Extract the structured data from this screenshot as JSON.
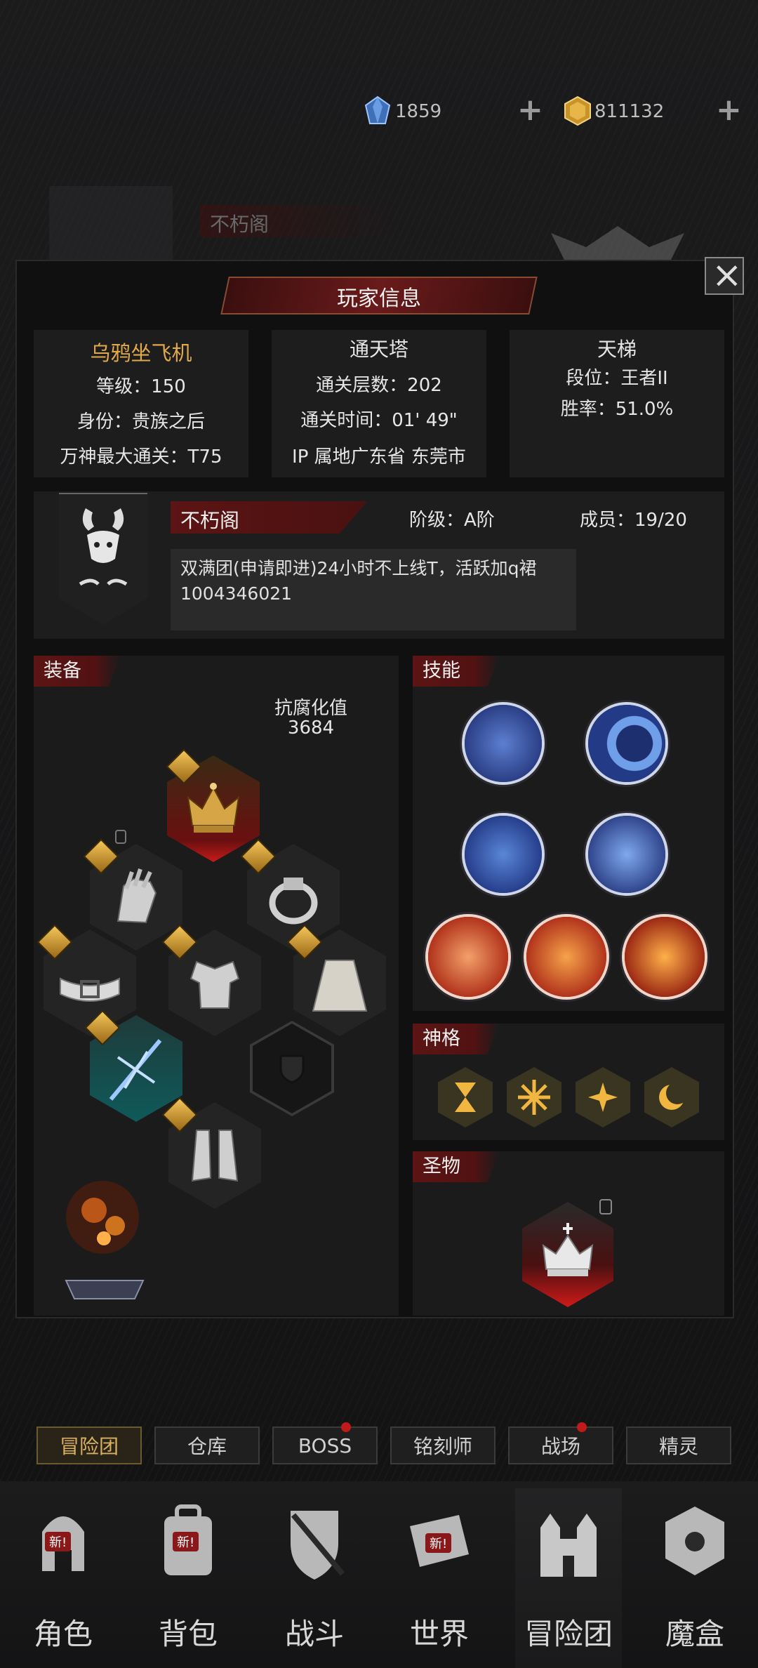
{
  "currency": {
    "gems": "1859",
    "gold": "811132",
    "plus": "+"
  },
  "background": {
    "guild_name": "不朽阁"
  },
  "dialog": {
    "title": "玩家信息",
    "close": "×"
  },
  "player": {
    "name": "乌鸦坐飞机",
    "level": "等级：150",
    "identity": "身份：贵族之后",
    "pantheon": "万神最大通关：T75"
  },
  "tower": {
    "title": "通天塔",
    "floors": "通关层数：202",
    "time": "通关时间：01' 49\"",
    "ip": "IP 属地广东省 东莞市"
  },
  "ladder": {
    "title": "天梯",
    "rank": "段位：王者II",
    "winrate": "胜率：51.0%"
  },
  "guild": {
    "name": "不朽阁",
    "tier": "阶级：A阶",
    "members": "成员：19/20",
    "notice": "双满团(申请即进)24小时不上线T，活跃加q裙1004346021"
  },
  "equipment": {
    "title": "装备",
    "resist_label": "抗腐化值",
    "resist_value": "3684",
    "slots": [
      "crown-icon",
      "gauntlet-icon",
      "ring-icon",
      "belt-icon",
      "armor-icon",
      "cloak-icon",
      "weapon-icon",
      "shield-icon",
      "greaves-icon"
    ]
  },
  "skills": {
    "title": "技能",
    "icons": [
      "blue-flame-icon",
      "crescent-moon-icon",
      "comet-icon",
      "serpent-icon",
      "shield-spiral-icon",
      "sun-moon-icon",
      "flame-demon-icon"
    ]
  },
  "divinity": {
    "title": "神格",
    "icons": [
      "hourglass-icon",
      "starburst-icon",
      "sparkle-icon",
      "moon-icon"
    ]
  },
  "relic": {
    "title": "圣物",
    "icon": "relic-crown-icon"
  },
  "bottom_tabs": [
    "冒险团",
    "仓库",
    "BOSS",
    "铭刻师",
    "战场",
    "精灵"
  ],
  "nav": {
    "new_badge": "新!",
    "items": [
      "角色",
      "背包",
      "战斗",
      "世界",
      "冒险团",
      "魔盒"
    ]
  },
  "colors": {
    "accent_red": "#5c1414",
    "gold_text": "#e2a94a"
  }
}
